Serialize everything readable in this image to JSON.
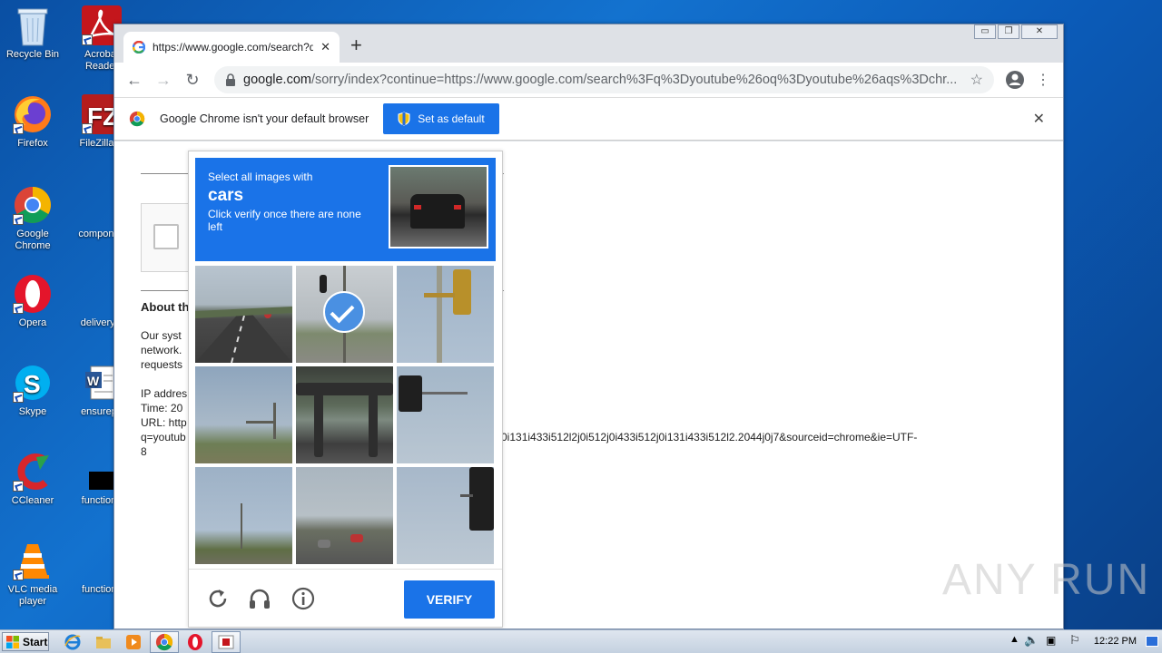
{
  "desktop": {
    "icons": [
      {
        "label": "Recycle Bin"
      },
      {
        "label": "Acrobat Reader"
      },
      {
        "label": "Firefox"
      },
      {
        "label": "FileZilla C"
      },
      {
        "label": "Google Chrome"
      },
      {
        "label": "componen"
      },
      {
        "label": "Opera"
      },
      {
        "label": "deliveryoi"
      },
      {
        "label": "Skype"
      },
      {
        "label": "ensurepa"
      },
      {
        "label": "CCleaner"
      },
      {
        "label": "functionp"
      },
      {
        "label": "VLC media player"
      },
      {
        "label": "functions"
      }
    ]
  },
  "browser": {
    "tab_title": "https://www.google.com/search?q=",
    "url_host": "google.com",
    "url_rest": "/sorry/index?continue=https://www.google.com/search%3Fq%3Dyoutube%26oq%3Dyoutube%26aqs%3Dchr...",
    "infobar_message": "Google Chrome isn't your default browser",
    "set_default_label": "Set as default",
    "window_controls": {
      "minimize": "▭",
      "restore": "❐",
      "close": "✕"
    }
  },
  "page": {
    "about_heading": "About th",
    "para_lines": [
      "Our syst",
      "network.",
      "requests"
    ],
    "ip_label": "IP addres",
    "time_label": "Time: 20",
    "url_label": "URL: http",
    "url_line2_left": "q=youtub",
    "url_line2_right": "0i131i433i512l2j0i512j0i433i512j0i131i433i512l2.2044j0j7&sourceid=chrome&ie=UTF-",
    "url_line3": "8"
  },
  "captcha": {
    "instruction": "Select all images with",
    "target": "cars",
    "hint": "Click verify once there are none left",
    "verify_label": "VERIFY",
    "tiles_selected": [
      false,
      true,
      false,
      false,
      false,
      false,
      false,
      false,
      false
    ]
  },
  "taskbar": {
    "start_label": "Start",
    "clock": "12:22 PM"
  },
  "watermark": "ANY RUN"
}
